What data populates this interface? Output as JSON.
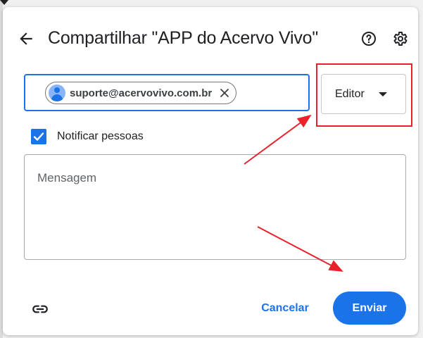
{
  "dialog": {
    "title": "Compartilhar \"APP do Acervo Vivo\"",
    "back_icon": "arrow-back-icon",
    "help_icon": "help-icon",
    "settings_icon": "gear-icon"
  },
  "recipients": {
    "chip_email": "suporte@acervovivo.com.br",
    "chip_avatar_icon": "person-avatar-icon",
    "chip_remove_icon": "close-icon"
  },
  "role_select": {
    "selected": "Editor",
    "caret_icon": "caret-down-icon"
  },
  "notify": {
    "label": "Notificar pessoas",
    "checked": true
  },
  "message": {
    "placeholder": "Mensagem"
  },
  "footer": {
    "link_icon": "link-icon",
    "cancel_label": "Cancelar",
    "send_label": "Enviar"
  },
  "colors": {
    "accent": "#1a73e8",
    "annotation": "#e8212b",
    "text": "#202124"
  }
}
